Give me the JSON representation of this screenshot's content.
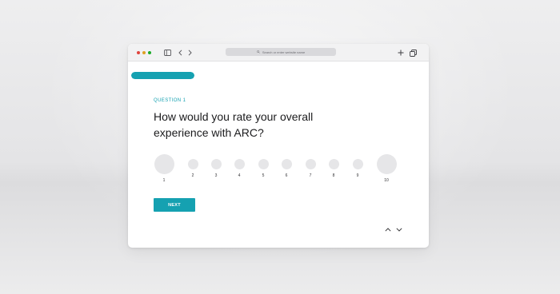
{
  "browser": {
    "address_placeholder": "Search or enter website name",
    "traffic_lights": {
      "close": "#e0443e",
      "minimize": "#dea123",
      "zoom": "#1aab29"
    }
  },
  "survey": {
    "progress_fraction": 0.1,
    "question_label": "QUESTION 1",
    "question_line1": "How would you rate your overall",
    "question_line2": "experience with ARC?",
    "scale": [
      "1",
      "2",
      "3",
      "4",
      "5",
      "6",
      "7",
      "8",
      "9",
      "10"
    ],
    "next_label": "NEXT",
    "accent_color": "#15a1b1"
  },
  "icons": {
    "sidebar": "sidebar-toggle-icon",
    "back": "chevron-left-icon",
    "forward": "chevron-right-icon",
    "search": "search-icon",
    "new_tab": "plus-icon",
    "tabs": "tabs-overview-icon",
    "pager_up": "chevron-up-icon",
    "pager_down": "chevron-down-icon"
  }
}
